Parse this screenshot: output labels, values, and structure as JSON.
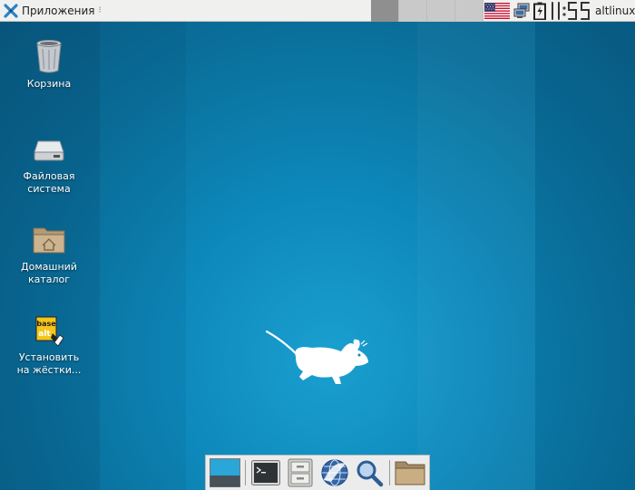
{
  "top_panel": {
    "apps_menu_label": "Приложения",
    "apps_menu_separator": "⁝",
    "clock": "11:55",
    "user": "altlinux",
    "keyboard_layout_icon": "us-flag-icon",
    "network_icon": "network-icon",
    "battery_icon": "battery-icon"
  },
  "desktop": {
    "icons": [
      {
        "label": "Корзина",
        "icon": "trash-icon"
      },
      {
        "label": "Файловая\nсистема",
        "icon": "drive-icon"
      },
      {
        "label": "Домашний\nкаталог",
        "icon": "home-folder-icon"
      },
      {
        "label": "Установить\nна жёстки...",
        "icon": "installer-icon"
      }
    ],
    "installer_badge_text": [
      "base",
      "alt"
    ]
  },
  "dock": {
    "items": [
      {
        "name": "show-desktop",
        "icon": "show-desktop-icon"
      },
      {
        "name": "terminal",
        "icon": "terminal-icon"
      },
      {
        "name": "file-manager",
        "icon": "file-cabinet-icon"
      },
      {
        "name": "web-browser",
        "icon": "browser-globe-icon"
      },
      {
        "name": "app-finder",
        "icon": "magnifier-icon"
      },
      {
        "name": "folder",
        "icon": "folder-icon"
      }
    ]
  },
  "colors": {
    "desktop_bg": "#0d88ba",
    "panel_bg": "#f0f0ef"
  }
}
